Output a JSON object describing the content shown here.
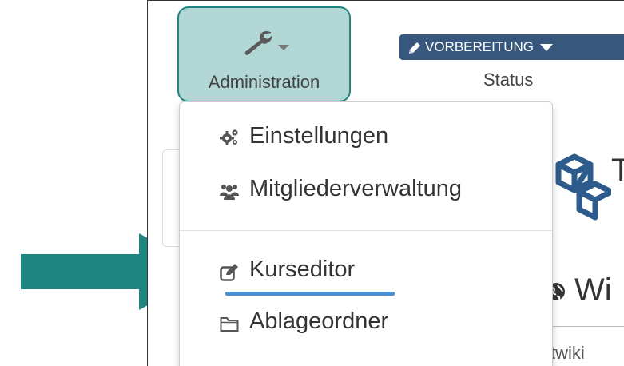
{
  "toolbar": {
    "administration": {
      "label": "Administration",
      "icon": "wrench-icon"
    },
    "status": {
      "button_label": "VORBEREITUNG",
      "label": "Status",
      "icon": "pencil-icon",
      "button_color": "#37587c"
    }
  },
  "admin_menu": {
    "items": [
      {
        "label": "Einstellungen",
        "icon": "cogs-icon"
      },
      {
        "label": "Mitgliederverwaltung",
        "icon": "users-icon"
      },
      {
        "label": "Kurseditor",
        "icon": "edit-icon"
      },
      {
        "label": "Ablageordner",
        "icon": "folder-icon"
      }
    ],
    "highlighted_item": "Kurseditor"
  },
  "background": {
    "wiki_title": "Wi",
    "wiki_subtitle": "stwiki",
    "title_glyph": "T"
  },
  "colors": {
    "highlight_bg": "#b3d7d5",
    "highlight_border": "#1f8580",
    "annotation_arrow": "#1f8580",
    "annotation_underline": "#4d8fd0"
  }
}
